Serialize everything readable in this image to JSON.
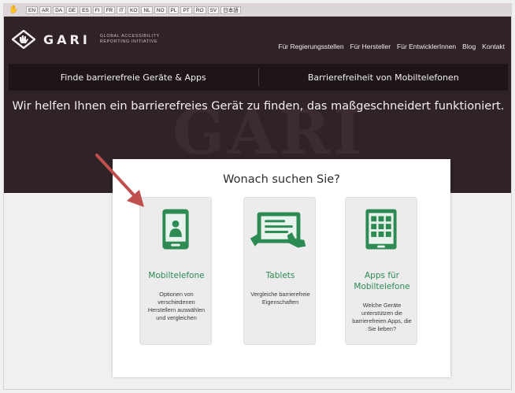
{
  "languages": [
    "EN",
    "AR",
    "DA",
    "DE",
    "ES",
    "FI",
    "FR",
    "IT",
    "KO",
    "NL",
    "NO",
    "PL",
    "PT",
    "RO",
    "SV",
    "日本語"
  ],
  "logo": {
    "name": "GARI",
    "subtitle_line1": "GLOBAL ACCESSIBILITY",
    "subtitle_line2": "REPORTING INITIATIVE"
  },
  "topnav": [
    "Für Regierungsstellen",
    "Für Hersteller",
    "Für EntwicklerInnen",
    "Blog",
    "Kontakt"
  ],
  "mainnav": [
    "Finde barrierefreie Geräte & Apps",
    "Barrierefreiheit von Mobiltelefonen"
  ],
  "tagline": "Wir helfen Ihnen ein barrierefreies Gerät zu finden, das maßgeschneidert funktioniert.",
  "watermark": "GARI",
  "card": {
    "title": "Wonach suchen Sie?",
    "tiles": [
      {
        "icon": "mobile-phone-icon",
        "label": "Mobiltelefone",
        "description": "Optionen von verschiedenen Herstellern auswählen und vergleichen"
      },
      {
        "icon": "tablet-icon",
        "label": "Tablets",
        "description": "Vergleiche barrierefreie Eigenschaften"
      },
      {
        "icon": "apps-icon",
        "label": "Apps für Mobiltelefone",
        "description": "Welche Geräte unterstützen die barrierefreien Apps, die Sie lieben?"
      }
    ]
  },
  "colors": {
    "header_bg": "#2f2326",
    "nav_bg": "#1d1518",
    "accent_green": "#2c8a52",
    "arrow_red": "#c0504d"
  }
}
